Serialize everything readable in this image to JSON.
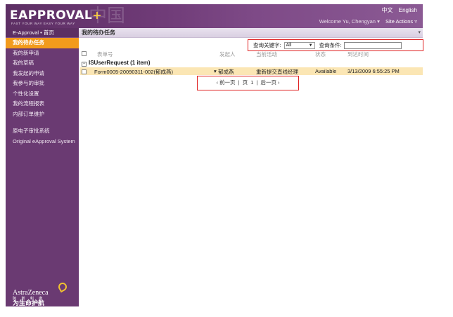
{
  "header": {
    "logo_text": "EAPPROVAL",
    "logo_plus": "+",
    "tagline": "FAST YOUR WAY EASY YOUR WAY",
    "watermark": "中国",
    "lang_chinese": "中文",
    "lang_english": "English",
    "welcome": "Welcome Yu, Chengyan",
    "site_actions": "Site Actions"
  },
  "sidebar": {
    "top_link": "E-Approval • 首页",
    "items": [
      {
        "label": "我的待办任务"
      },
      {
        "label": "我的新申请"
      },
      {
        "label": "我的草稿"
      },
      {
        "label": "我发起的申请"
      },
      {
        "label": "我参与的审批"
      },
      {
        "label": "个性化设置"
      },
      {
        "label": "我的流程报表"
      },
      {
        "label": "内部订单维护"
      }
    ],
    "legacy": [
      {
        "label": "原电子审批系统"
      },
      {
        "label": "Original eApproval System"
      }
    ],
    "brand": "AstraZeneca",
    "brand_cn": "阿 斯 利 康",
    "slogan": "为生命护航"
  },
  "main": {
    "page_title": "我的待办任务",
    "search": {
      "keyword_label": "查询关键字:",
      "keyword_value": "All",
      "condition_label": "查询条件:",
      "condition_value": ""
    },
    "columns": [
      "表单号",
      "发起人",
      "当前活动",
      "状态",
      "到达时间"
    ],
    "group": {
      "label": "ISUserRequest (1 item)"
    },
    "rows": [
      {
        "form_no": "Form0005-20090311-002(郁成燕)",
        "initiator": "郁成燕",
        "activity": "重新提交直线经理",
        "status": "Available",
        "arrival": "3/13/2009 6:55:25 PM"
      }
    ],
    "pager": {
      "prev": "前一页",
      "page_label": "页",
      "page_number": "1",
      "next": "后一页"
    }
  }
}
